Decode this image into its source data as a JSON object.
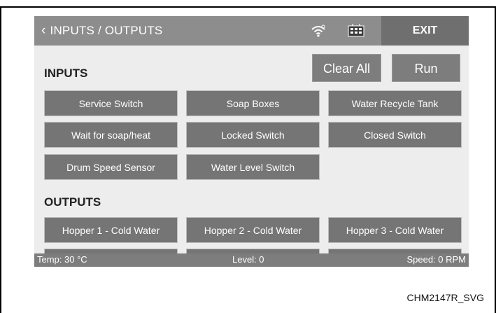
{
  "header": {
    "title": "INPUTS / OUTPUTS",
    "back_icon": "chevron-left-icon",
    "wifi_icon": "wifi-icon",
    "network_icon": "network-box-icon",
    "exit_label": "EXIT"
  },
  "actions": {
    "clear_all": "Clear All",
    "run": "Run"
  },
  "inputs": {
    "title": "INPUTS",
    "items": [
      "Service Switch",
      "Soap Boxes",
      "Water Recycle Tank",
      "Wait for soap/heat",
      "Locked Switch",
      "Closed Switch",
      "Drum Speed Sensor",
      "Water Level Switch"
    ]
  },
  "outputs": {
    "title": "OUTPUTS",
    "items": [
      "Hopper 1 - Cold Water",
      "Hopper 2 - Cold Water",
      "Hopper 3 - Cold Water"
    ]
  },
  "status": {
    "temp": "Temp: 30 °C",
    "level": "Level: 0",
    "speed": "Speed: 0 RPM"
  },
  "footer": {
    "label": "CHM2147R_SVG"
  },
  "colors": {
    "header": "#8d8d8d",
    "exit": "#6f6f6f",
    "button": "#757575",
    "screen_bg": "#ededed"
  }
}
